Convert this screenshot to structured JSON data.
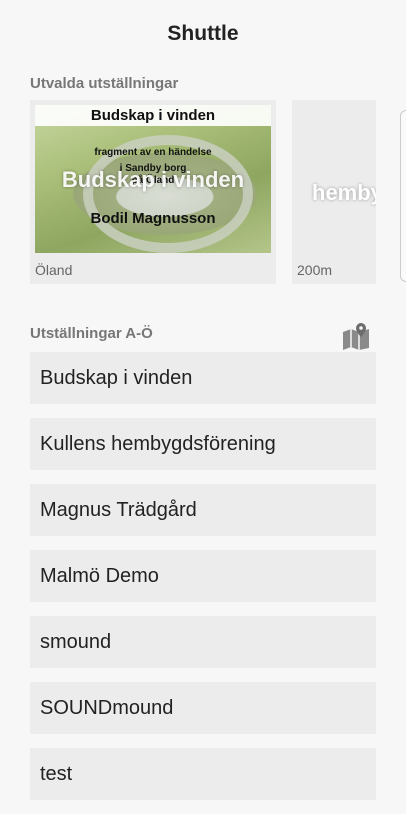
{
  "app": {
    "title": "Shuttle"
  },
  "featured": {
    "heading": "Utvalda utställningar",
    "cards": [
      {
        "image_title": "Budskap i vinden",
        "image_lines": [
          "fragment av en händelse",
          "i Sandby borg",
          "på Öland"
        ],
        "overlay_title": "Budskap i vinden",
        "image_author": "Bodil Magnusson",
        "caption": "Öland"
      },
      {
        "overlay_title": "hembygdsförening",
        "caption": "200m"
      }
    ]
  },
  "list": {
    "heading": "Utställningar A-Ö",
    "map_icon": "map-icon",
    "items": [
      "Budskap i vinden",
      "Kullens hembygdsförening",
      "Magnus Trädgård",
      "Malmö Demo",
      "smound",
      "SOUNDmound",
      "test"
    ]
  }
}
